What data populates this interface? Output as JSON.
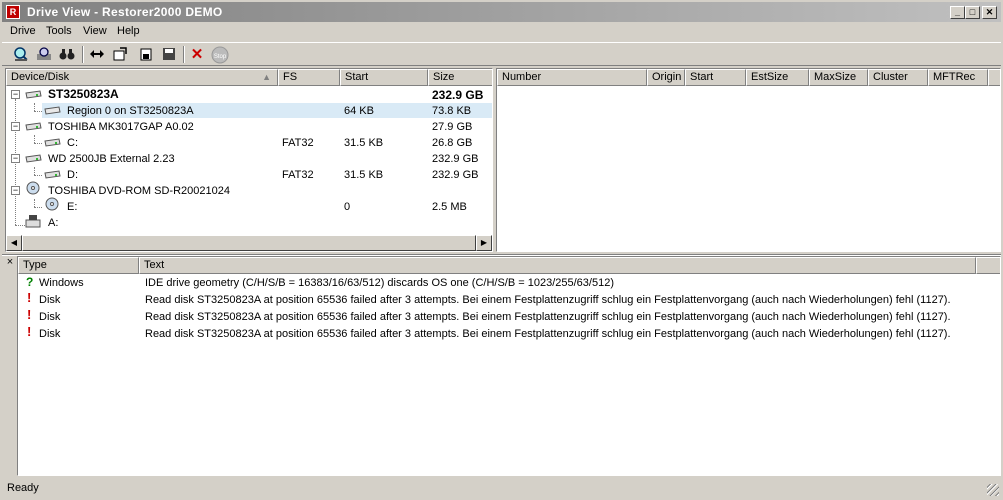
{
  "window": {
    "title": "Drive View - Restorer2000 DEMO",
    "app_icon_text": "R",
    "min_glyph": "_",
    "max_glyph": "□",
    "close_glyph": "✕"
  },
  "menu": [
    {
      "label": "Drive"
    },
    {
      "label": "Tools"
    },
    {
      "label": "View"
    },
    {
      "label": "Help"
    }
  ],
  "toolbar": {
    "icons": [
      "scan-icon",
      "search-icon",
      "binoculars-icon",
      "resize-icon",
      "open-icon",
      "save-icon",
      "floppy-icon",
      "stop-x-icon",
      "stop-icon"
    ],
    "stop_label": "Stop"
  },
  "drive_tree": {
    "columns": [
      "Device/Disk",
      "FS",
      "Start",
      "Size"
    ],
    "rows": [
      {
        "name": "ST3250823A",
        "fs": "",
        "start": "",
        "size": "232.9 GB",
        "level": 0,
        "bold": true
      },
      {
        "name": "Region 0 on ST3250823A",
        "fs": "",
        "start": "64 KB",
        "size": "73.8 KB",
        "level": 1,
        "selected": true
      },
      {
        "name": "TOSHIBA MK3017GAP A0.02",
        "fs": "",
        "start": "",
        "size": "27.9 GB",
        "level": 0
      },
      {
        "name": "C:",
        "fs": "FAT32",
        "start": "31.5 KB",
        "size": "26.8 GB",
        "level": 1
      },
      {
        "name": "WD 2500JB External 2.23",
        "fs": "",
        "start": "",
        "size": "232.9 GB",
        "level": 0
      },
      {
        "name": "D:",
        "fs": "FAT32",
        "start": "31.5 KB",
        "size": "232.9 GB",
        "level": 1
      },
      {
        "name": "TOSHIBA DVD-ROM SD-R20021024",
        "fs": "",
        "start": "",
        "size": "",
        "level": 0
      },
      {
        "name": "E:",
        "fs": "",
        "start": "0",
        "size": "2.5 MB",
        "level": 1
      },
      {
        "name": "A:",
        "fs": "",
        "start": "",
        "size": "",
        "level": 0
      }
    ]
  },
  "partition_table": {
    "columns": [
      "Number",
      "Origin",
      "Start",
      "EstSize",
      "MaxSize",
      "Cluster",
      "MFTRec"
    ]
  },
  "log": {
    "close_glyph": "×",
    "columns": [
      "Type",
      "Text"
    ],
    "rows": [
      {
        "type": "Windows",
        "severity": "info",
        "text": "IDE drive geometry (C/H/S/B = 16383/16/63/512) discards OS one (C/H/S/B = 1023/255/63/512)"
      },
      {
        "type": "Disk",
        "severity": "error",
        "text": "Read disk ST3250823A at position 65536 failed after 3 attempts. Bei einem Festplattenzugriff schlug ein Festplattenvorgang (auch nach Wiederholungen) fehl (1127)."
      },
      {
        "type": "Disk",
        "severity": "error",
        "text": "Read disk ST3250823A at position 65536 failed after 3 attempts. Bei einem Festplattenzugriff schlug ein Festplattenvorgang (auch nach Wiederholungen) fehl (1127)."
      },
      {
        "type": "Disk",
        "severity": "error",
        "text": "Read disk ST3250823A at position 65536 failed after 3 attempts. Bei einem Festplattenzugriff schlug ein Festplattenvorgang (auch nach Wiederholungen) fehl (1127)."
      }
    ],
    "severity_glyphs": {
      "info": "?",
      "error": "!"
    },
    "colors": {
      "info": "#008000",
      "error": "#cc0000"
    }
  },
  "status_bar": {
    "text": "Ready"
  }
}
